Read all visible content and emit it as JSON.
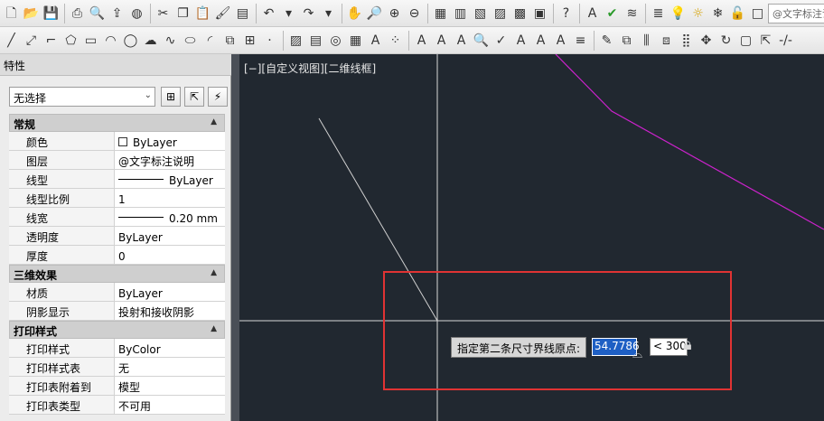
{
  "toolbar_top": {
    "layer_combo": "@文字标注说明"
  },
  "palette": {
    "title": "特性",
    "selection": "无选择",
    "sections": [
      {
        "title": "常规",
        "rows": [
          {
            "label": "颜色",
            "value": "ByLayer"
          },
          {
            "label": "图层",
            "value": "@文字标注说明"
          },
          {
            "label": "线型",
            "value": "ByLayer"
          },
          {
            "label": "线型比例",
            "value": "1"
          },
          {
            "label": "线宽",
            "value": "0.20 mm"
          },
          {
            "label": "透明度",
            "value": "ByLayer"
          },
          {
            "label": "厚度",
            "value": "0"
          }
        ]
      },
      {
        "title": "三维效果",
        "rows": [
          {
            "label": "材质",
            "value": "ByLayer"
          },
          {
            "label": "阴影显示",
            "value": "投射和接收阴影"
          }
        ]
      },
      {
        "title": "打印样式",
        "rows": [
          {
            "label": "打印样式",
            "value": "ByColor"
          },
          {
            "label": "打印样式表",
            "value": "无"
          },
          {
            "label": "打印表附着到",
            "value": "模型"
          },
          {
            "label": "打印表类型",
            "value": "不可用"
          }
        ]
      }
    ]
  },
  "canvas": {
    "view_label": "[−][自定义视图][二维线框]",
    "prompt": "指定第二条尺寸界线原点:",
    "length_input": "54.7786",
    "angle_input": "< 300°",
    "colors": {
      "background": "#212830",
      "magenta": "#cc22cc",
      "highlight": "#e03333"
    }
  }
}
